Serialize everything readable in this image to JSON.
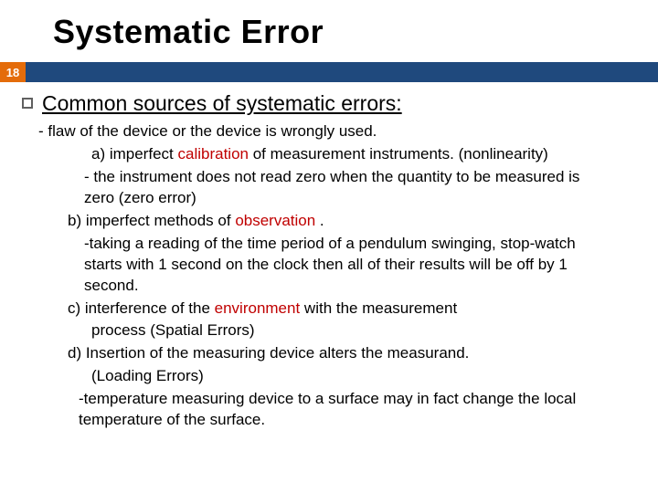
{
  "slide": {
    "title": "Systematic Error",
    "pageNumber": "18",
    "lead": "Common sources of systematic errors:",
    "flaw": "- flaw of the device or the device is wrongly used.",
    "a_pre": "a) imperfect ",
    "a_red": "calibration",
    "a_post": " of measurement instruments. (nonlinearity)",
    "a_note": "- the instrument does not read zero when the quantity to be measured is zero (zero error)",
    "b_pre": "b) imperfect methods of ",
    "b_red": "observation",
    "b_post": " .",
    "b_note": "-taking a reading of the time period of a pendulum swinging, stop-watch starts with 1 second on the clock then all of their results will be off by 1 second.",
    "c_pre": "c) interference of the ",
    "c_red": "environment",
    "c_post": " with the measurement",
    "c_in": "process (Spatial Errors)",
    "d_pre": "d) Insertion of the measuring device alters the measurand.",
    "d_in": "(Loading Errors)",
    "d_note": "-temperature measuring device to a surface may in fact change the local temperature of the surface."
  }
}
